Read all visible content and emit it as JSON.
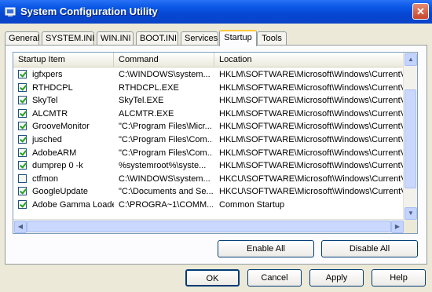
{
  "window": {
    "title": "System Configuration Utility",
    "close_glyph": "✕"
  },
  "tabs": [
    {
      "label": "General"
    },
    {
      "label": "SYSTEM.INI"
    },
    {
      "label": "WIN.INI"
    },
    {
      "label": "BOOT.INI"
    },
    {
      "label": "Services"
    },
    {
      "label": "Startup",
      "active": true
    },
    {
      "label": "Tools"
    }
  ],
  "columns": [
    "Startup Item",
    "Command",
    "Location"
  ],
  "startup_items": [
    {
      "name": "igfxpers",
      "command": "C:\\WINDOWS\\system...",
      "location": "HKLM\\SOFTWARE\\Microsoft\\Windows\\CurrentVer...",
      "checked": true
    },
    {
      "name": "RTHDCPL",
      "command": "RTHDCPL.EXE",
      "location": "HKLM\\SOFTWARE\\Microsoft\\Windows\\CurrentVer...",
      "checked": true
    },
    {
      "name": "SkyTel",
      "command": "SkyTel.EXE",
      "location": "HKLM\\SOFTWARE\\Microsoft\\Windows\\CurrentVer...",
      "checked": true
    },
    {
      "name": "ALCMTR",
      "command": "ALCMTR.EXE",
      "location": "HKLM\\SOFTWARE\\Microsoft\\Windows\\CurrentVer...",
      "checked": true
    },
    {
      "name": "GrooveMonitor",
      "command": "\"C:\\Program Files\\Micr...",
      "location": "HKLM\\SOFTWARE\\Microsoft\\Windows\\CurrentVer...",
      "checked": true
    },
    {
      "name": "jusched",
      "command": "\"C:\\Program Files\\Com...",
      "location": "HKLM\\SOFTWARE\\Microsoft\\Windows\\CurrentVer...",
      "checked": true
    },
    {
      "name": "AdobeARM",
      "command": "\"C:\\Program Files\\Com...",
      "location": "HKLM\\SOFTWARE\\Microsoft\\Windows\\CurrentVer...",
      "checked": true
    },
    {
      "name": "dumprep 0 -k",
      "command": "%systemroot%\\syste...",
      "location": "HKLM\\SOFTWARE\\Microsoft\\Windows\\CurrentVer...",
      "checked": true
    },
    {
      "name": "ctfmon",
      "command": "C:\\WINDOWS\\system...",
      "location": "HKCU\\SOFTWARE\\Microsoft\\Windows\\CurrentVer...",
      "checked": false
    },
    {
      "name": "GoogleUpdate",
      "command": "\"C:\\Documents and Se...",
      "location": "HKCU\\SOFTWARE\\Microsoft\\Windows\\CurrentVer...",
      "checked": true
    },
    {
      "name": "Adobe Gamma Loader",
      "command": "C:\\PROGRA~1\\COMM...",
      "location": "Common Startup",
      "checked": true
    }
  ],
  "buttons": {
    "enable_all": "Enable All",
    "disable_all": "Disable All",
    "ok": "OK",
    "cancel": "Cancel",
    "apply": "Apply",
    "help": "Help"
  },
  "scroll": {
    "up": "▲",
    "down": "▼",
    "left": "◀",
    "right": "▶"
  }
}
